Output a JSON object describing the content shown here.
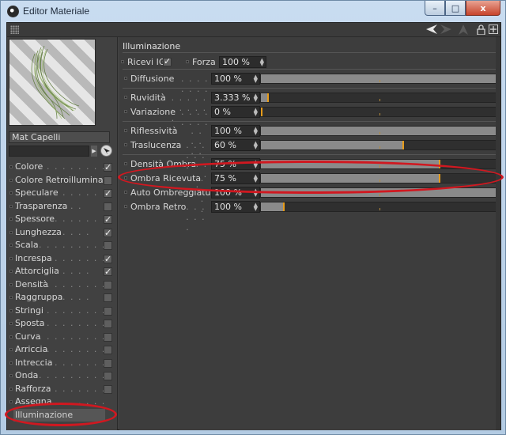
{
  "window": {
    "title": "Editor Materiale",
    "controls": {
      "minimize": "–",
      "maximize": "□",
      "close": "x"
    }
  },
  "toolbar": {
    "icons": [
      "arrow-left-icon",
      "arrow-right-icon",
      "arrow-up-icon",
      "lock-icon",
      "new-window-icon"
    ]
  },
  "material": {
    "name": "Mat Capelli"
  },
  "channels": [
    {
      "label": "Colore",
      "dots": ". . . . . . . . . . . . . .",
      "checked": true
    },
    {
      "label": "Colore Retroilluminato",
      "dots": "",
      "checked": false
    },
    {
      "label": "Speculare",
      "dots": ". . . . . . . . . . .",
      "checked": true
    },
    {
      "label": "Trasparenza",
      "dots": ". . . . . . . . .",
      "checked": false
    },
    {
      "label": "Spessore",
      "dots": ". . . . . . . . . . .",
      "checked": true
    },
    {
      "label": "Lunghezza",
      "dots": ". . . . . . . . . .",
      "checked": true
    },
    {
      "label": "Scala",
      "dots": ". . . . . . . . . . . . . .",
      "checked": false
    },
    {
      "label": "Increspa",
      "dots": ". . . . . . . . . . . .",
      "checked": true
    },
    {
      "label": "Attorciglia",
      "dots": ". . . . . . . . . .",
      "checked": true
    },
    {
      "label": "Densità",
      "dots": ". . . . . . . . . . . .",
      "checked": false
    },
    {
      "label": "Raggruppa",
      "dots": ". . . . . . . . . .",
      "checked": false
    },
    {
      "label": "Stringi",
      "dots": ". . . . . . . . . . . . .",
      "checked": false
    },
    {
      "label": "Sposta",
      "dots": ". . . . . . . . . . . . .",
      "checked": false
    },
    {
      "label": "Curva",
      "dots": ". . . . . . . . . . . . . .",
      "checked": false
    },
    {
      "label": "Arriccia",
      "dots": ". . . . . . . . . . . . .",
      "checked": false
    },
    {
      "label": "Intreccia",
      "dots": ". . . . . . . . . . . .",
      "checked": false
    },
    {
      "label": "Onda",
      "dots": ". . . . . . . . . . . . . .",
      "checked": false
    },
    {
      "label": "Rafforza",
      "dots": ". . . . . . . . . . . . .",
      "checked": false
    },
    {
      "label": "Assegna",
      "dots": ". . . . . . . . . . . . .",
      "checked": null
    },
    {
      "label": "Illuminazione",
      "dots": ". . . . . . . .",
      "checked": null,
      "selected": true
    }
  ],
  "panel": {
    "title": "Illuminazione",
    "ricevi_ig": {
      "label": "Ricevi IG",
      "checked": true
    },
    "forza": {
      "label": "Forza",
      "value": "100 %"
    },
    "groups": [
      [
        {
          "label": "Diffusione",
          "dots": ". . . . . . . .",
          "value": "100 %",
          "level": 1.0
        }
      ],
      [
        {
          "label": "Ruvidità",
          "dots": ". . . . . . . . . . .",
          "value": "3.333 %",
          "level": 0.033
        },
        {
          "label": "Variazione",
          "dots": ". . . . . . . .",
          "value": "0 %",
          "level": 0.0
        }
      ],
      [
        {
          "label": "Riflessività",
          "dots": ". . . . . . .",
          "value": "100 %",
          "level": 1.0
        },
        {
          "label": "Traslucenza",
          "dots": ". . . . . . .",
          "value": "60 %",
          "level": 0.6
        }
      ],
      [
        {
          "label": "Densità Ombra",
          "dots": ". . . . .",
          "value": "75 %",
          "level": 0.75
        },
        {
          "label": "Ombra Ricevuta",
          "dots": ". . . .",
          "value": "75 %",
          "level": 0.75
        },
        {
          "label": "Auto Ombreggiatura",
          "dots": "",
          "value": "100 %",
          "level": 1.0
        },
        {
          "label": "Ombra Retro",
          "dots": ". . . . . . .",
          "value": "100 %",
          "level": 0.1
        }
      ]
    ]
  },
  "colors": {
    "background": "#414141",
    "slider_fill": "#8a8a8a",
    "slider_knob": "#e79c1a",
    "highlight_marker": "#d01820"
  }
}
